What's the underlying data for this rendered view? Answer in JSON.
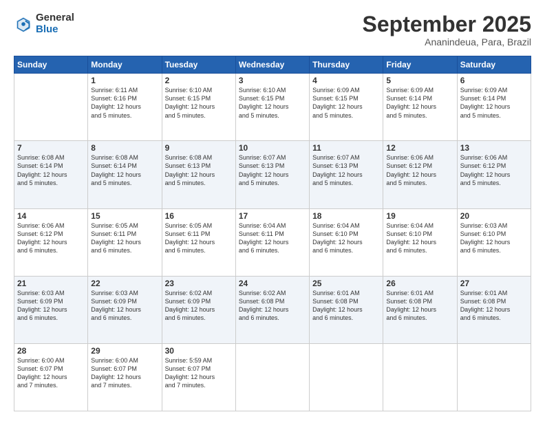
{
  "logo": {
    "general": "General",
    "blue": "Blue"
  },
  "header": {
    "month": "September 2025",
    "location": "Ananindeua, Para, Brazil"
  },
  "weekdays": [
    "Sunday",
    "Monday",
    "Tuesday",
    "Wednesday",
    "Thursday",
    "Friday",
    "Saturday"
  ],
  "weeks": [
    [
      {
        "day": "",
        "info": ""
      },
      {
        "day": "1",
        "info": "Sunrise: 6:11 AM\nSunset: 6:16 PM\nDaylight: 12 hours\nand 5 minutes."
      },
      {
        "day": "2",
        "info": "Sunrise: 6:10 AM\nSunset: 6:15 PM\nDaylight: 12 hours\nand 5 minutes."
      },
      {
        "day": "3",
        "info": "Sunrise: 6:10 AM\nSunset: 6:15 PM\nDaylight: 12 hours\nand 5 minutes."
      },
      {
        "day": "4",
        "info": "Sunrise: 6:09 AM\nSunset: 6:15 PM\nDaylight: 12 hours\nand 5 minutes."
      },
      {
        "day": "5",
        "info": "Sunrise: 6:09 AM\nSunset: 6:14 PM\nDaylight: 12 hours\nand 5 minutes."
      },
      {
        "day": "6",
        "info": "Sunrise: 6:09 AM\nSunset: 6:14 PM\nDaylight: 12 hours\nand 5 minutes."
      }
    ],
    [
      {
        "day": "7",
        "info": "Sunrise: 6:08 AM\nSunset: 6:14 PM\nDaylight: 12 hours\nand 5 minutes."
      },
      {
        "day": "8",
        "info": "Sunrise: 6:08 AM\nSunset: 6:14 PM\nDaylight: 12 hours\nand 5 minutes."
      },
      {
        "day": "9",
        "info": "Sunrise: 6:08 AM\nSunset: 6:13 PM\nDaylight: 12 hours\nand 5 minutes."
      },
      {
        "day": "10",
        "info": "Sunrise: 6:07 AM\nSunset: 6:13 PM\nDaylight: 12 hours\nand 5 minutes."
      },
      {
        "day": "11",
        "info": "Sunrise: 6:07 AM\nSunset: 6:13 PM\nDaylight: 12 hours\nand 5 minutes."
      },
      {
        "day": "12",
        "info": "Sunrise: 6:06 AM\nSunset: 6:12 PM\nDaylight: 12 hours\nand 5 minutes."
      },
      {
        "day": "13",
        "info": "Sunrise: 6:06 AM\nSunset: 6:12 PM\nDaylight: 12 hours\nand 5 minutes."
      }
    ],
    [
      {
        "day": "14",
        "info": "Sunrise: 6:06 AM\nSunset: 6:12 PM\nDaylight: 12 hours\nand 6 minutes."
      },
      {
        "day": "15",
        "info": "Sunrise: 6:05 AM\nSunset: 6:11 PM\nDaylight: 12 hours\nand 6 minutes."
      },
      {
        "day": "16",
        "info": "Sunrise: 6:05 AM\nSunset: 6:11 PM\nDaylight: 12 hours\nand 6 minutes."
      },
      {
        "day": "17",
        "info": "Sunrise: 6:04 AM\nSunset: 6:11 PM\nDaylight: 12 hours\nand 6 minutes."
      },
      {
        "day": "18",
        "info": "Sunrise: 6:04 AM\nSunset: 6:10 PM\nDaylight: 12 hours\nand 6 minutes."
      },
      {
        "day": "19",
        "info": "Sunrise: 6:04 AM\nSunset: 6:10 PM\nDaylight: 12 hours\nand 6 minutes."
      },
      {
        "day": "20",
        "info": "Sunrise: 6:03 AM\nSunset: 6:10 PM\nDaylight: 12 hours\nand 6 minutes."
      }
    ],
    [
      {
        "day": "21",
        "info": "Sunrise: 6:03 AM\nSunset: 6:09 PM\nDaylight: 12 hours\nand 6 minutes."
      },
      {
        "day": "22",
        "info": "Sunrise: 6:03 AM\nSunset: 6:09 PM\nDaylight: 12 hours\nand 6 minutes."
      },
      {
        "day": "23",
        "info": "Sunrise: 6:02 AM\nSunset: 6:09 PM\nDaylight: 12 hours\nand 6 minutes."
      },
      {
        "day": "24",
        "info": "Sunrise: 6:02 AM\nSunset: 6:08 PM\nDaylight: 12 hours\nand 6 minutes."
      },
      {
        "day": "25",
        "info": "Sunrise: 6:01 AM\nSunset: 6:08 PM\nDaylight: 12 hours\nand 6 minutes."
      },
      {
        "day": "26",
        "info": "Sunrise: 6:01 AM\nSunset: 6:08 PM\nDaylight: 12 hours\nand 6 minutes."
      },
      {
        "day": "27",
        "info": "Sunrise: 6:01 AM\nSunset: 6:08 PM\nDaylight: 12 hours\nand 6 minutes."
      }
    ],
    [
      {
        "day": "28",
        "info": "Sunrise: 6:00 AM\nSunset: 6:07 PM\nDaylight: 12 hours\nand 7 minutes."
      },
      {
        "day": "29",
        "info": "Sunrise: 6:00 AM\nSunset: 6:07 PM\nDaylight: 12 hours\nand 7 minutes."
      },
      {
        "day": "30",
        "info": "Sunrise: 5:59 AM\nSunset: 6:07 PM\nDaylight: 12 hours\nand 7 minutes."
      },
      {
        "day": "",
        "info": ""
      },
      {
        "day": "",
        "info": ""
      },
      {
        "day": "",
        "info": ""
      },
      {
        "day": "",
        "info": ""
      }
    ]
  ]
}
